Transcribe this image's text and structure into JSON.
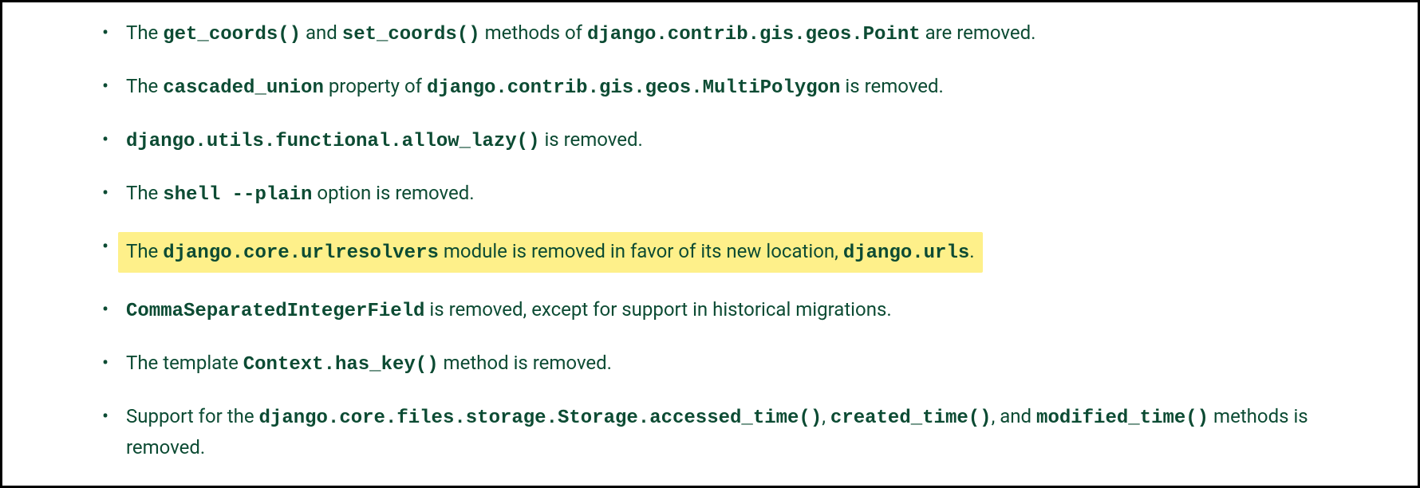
{
  "items": [
    {
      "parts": [
        {
          "type": "text",
          "value": "The "
        },
        {
          "type": "code",
          "value": "get_coords()"
        },
        {
          "type": "text",
          "value": " and "
        },
        {
          "type": "code",
          "value": "set_coords()"
        },
        {
          "type": "text",
          "value": " methods of "
        },
        {
          "type": "code",
          "value": "django.contrib.gis.geos.Point"
        },
        {
          "type": "text",
          "value": " are removed."
        }
      ],
      "highlighted": false
    },
    {
      "parts": [
        {
          "type": "text",
          "value": "The "
        },
        {
          "type": "code",
          "value": "cascaded_union"
        },
        {
          "type": "text",
          "value": " property of "
        },
        {
          "type": "code",
          "value": "django.contrib.gis.geos.MultiPolygon"
        },
        {
          "type": "text",
          "value": " is removed."
        }
      ],
      "highlighted": false
    },
    {
      "parts": [
        {
          "type": "code",
          "value": "django.utils.functional.allow_lazy()"
        },
        {
          "type": "text",
          "value": " is removed."
        }
      ],
      "highlighted": false
    },
    {
      "parts": [
        {
          "type": "text",
          "value": "The "
        },
        {
          "type": "code",
          "value": "shell --plain"
        },
        {
          "type": "text",
          "value": " option is removed."
        }
      ],
      "highlighted": false
    },
    {
      "parts": [
        {
          "type": "text",
          "value": "The "
        },
        {
          "type": "code",
          "value": "django.core.urlresolvers"
        },
        {
          "type": "text",
          "value": " module is removed in favor of its new location, "
        },
        {
          "type": "code",
          "value": "django.urls"
        },
        {
          "type": "text",
          "value": "."
        }
      ],
      "highlighted": true
    },
    {
      "parts": [
        {
          "type": "code",
          "value": "CommaSeparatedIntegerField"
        },
        {
          "type": "text",
          "value": " is removed, except for support in historical migrations."
        }
      ],
      "highlighted": false
    },
    {
      "parts": [
        {
          "type": "text",
          "value": "The template "
        },
        {
          "type": "code",
          "value": "Context.has_key()"
        },
        {
          "type": "text",
          "value": " method is removed."
        }
      ],
      "highlighted": false
    },
    {
      "parts": [
        {
          "type": "text",
          "value": "Support for the "
        },
        {
          "type": "code",
          "value": "django.core.files.storage.Storage.accessed_time()"
        },
        {
          "type": "text",
          "value": ", "
        },
        {
          "type": "code",
          "value": "created_time()"
        },
        {
          "type": "text",
          "value": ", and "
        },
        {
          "type": "code",
          "value": "modified_time()"
        },
        {
          "type": "text",
          "value": " methods is removed."
        }
      ],
      "highlighted": false
    }
  ]
}
